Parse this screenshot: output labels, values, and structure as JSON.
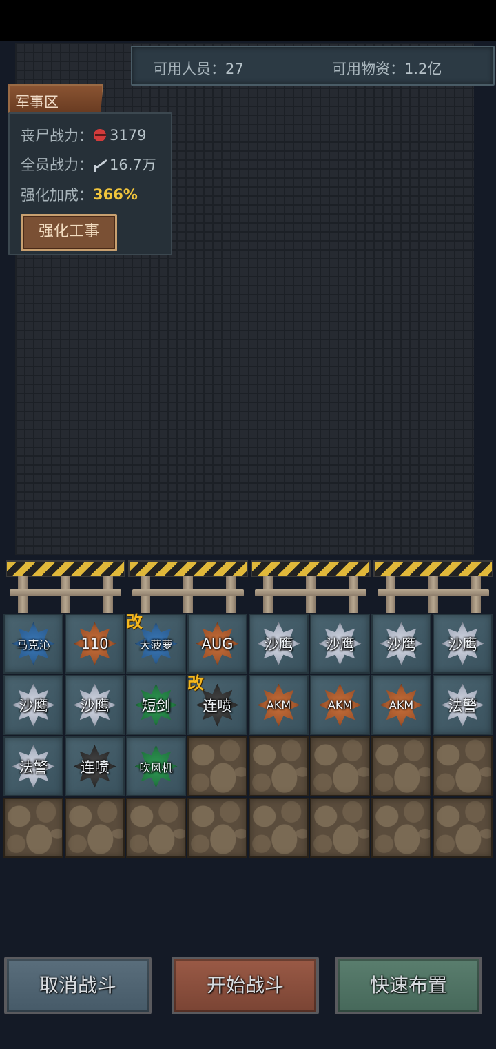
{
  "resources": {
    "people_label": "可用人员：",
    "people_value": "27",
    "supplies_label": "可用物资：",
    "supplies_value": "1.2亿"
  },
  "zone": {
    "label": "军事区"
  },
  "stats": {
    "zombie_power_label": "丧尸战力：",
    "zombie_power_value": "3179",
    "zombie_icon": "zombie-icon",
    "team_power_label": "全员战力：",
    "team_power_value": "16.7万",
    "team_icon": "gun-icon",
    "boost_label": "强化加成：",
    "boost_value": "366%",
    "fortify_button": "强化工事"
  },
  "weapons": [
    {
      "label": "马克沁",
      "color": "blue",
      "modified": false,
      "small": true
    },
    {
      "label": "110",
      "color": "orange",
      "modified": false,
      "small": false
    },
    {
      "label": "大菠萝",
      "color": "blue",
      "modified": true,
      "small": true
    },
    {
      "label": "AUG",
      "color": "orange",
      "modified": false,
      "small": false
    },
    {
      "label": "沙鹰",
      "color": "silver",
      "modified": false,
      "small": false
    },
    {
      "label": "沙鹰",
      "color": "silver",
      "modified": false,
      "small": false
    },
    {
      "label": "沙鹰",
      "color": "silver",
      "modified": false,
      "small": false
    },
    {
      "label": "沙鹰",
      "color": "silver",
      "modified": false,
      "small": false
    },
    {
      "label": "沙鹰",
      "color": "silver",
      "modified": false,
      "small": false
    },
    {
      "label": "沙鹰",
      "color": "silver",
      "modified": false,
      "small": false
    },
    {
      "label": "短剑",
      "color": "green",
      "modified": false,
      "small": false
    },
    {
      "label": "连喷",
      "color": "black",
      "modified": true,
      "small": false
    },
    {
      "label": "AKM",
      "color": "orange",
      "modified": false,
      "small": true
    },
    {
      "label": "AKM",
      "color": "orange",
      "modified": false,
      "small": true
    },
    {
      "label": "AKM",
      "color": "orange",
      "modified": false,
      "small": true
    },
    {
      "label": "法警",
      "color": "silver",
      "modified": false,
      "small": false
    },
    {
      "label": "法警",
      "color": "silver",
      "modified": false,
      "small": false
    },
    {
      "label": "连喷",
      "color": "black",
      "modified": false,
      "small": false
    },
    {
      "label": "吹风机",
      "color": "green",
      "modified": false,
      "small": true
    }
  ],
  "mod_tag": "改",
  "buttons": {
    "cancel": "取消战斗",
    "start": "开始战斗",
    "quick": "快速布置"
  }
}
